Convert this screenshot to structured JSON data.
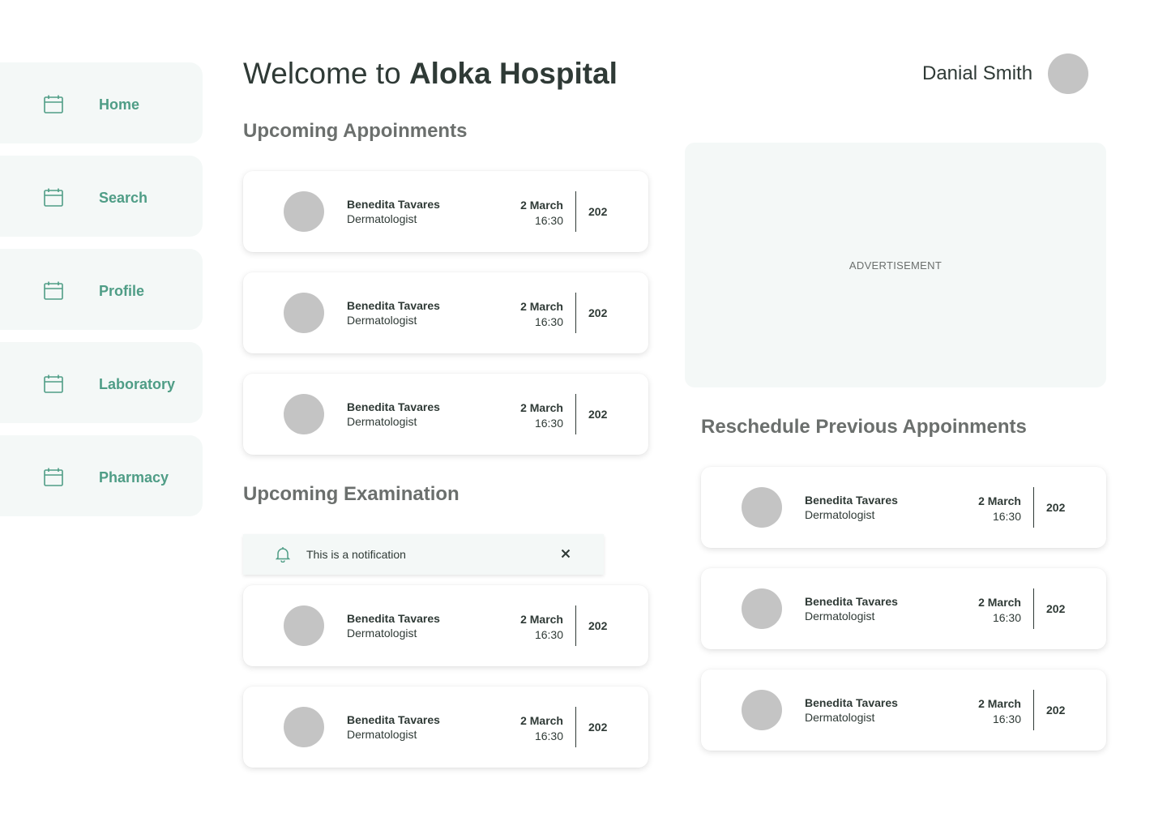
{
  "header": {
    "title_prefix": "Welcome to ",
    "title_brand": "Aloka Hospital",
    "user_name": "Danial Smith"
  },
  "sidebar": {
    "items": [
      {
        "label": "Home",
        "icon": "calendar-icon"
      },
      {
        "label": "Search",
        "icon": "calendar-icon"
      },
      {
        "label": "Profile",
        "icon": "calendar-icon"
      },
      {
        "label": "Laboratory",
        "icon": "calendar-icon"
      },
      {
        "label": "Pharmacy",
        "icon": "calendar-icon"
      }
    ]
  },
  "upcoming_appointments": {
    "title": "Upcoming  Appoinments",
    "cards": [
      {
        "name": "Benedita Tavares",
        "specialty": "Dermatologist",
        "date": "2 March",
        "time": "16:30",
        "room": "202"
      },
      {
        "name": "Benedita Tavares",
        "specialty": "Dermatologist",
        "date": "2 March",
        "time": "16:30",
        "room": "202"
      },
      {
        "name": "Benedita Tavares",
        "specialty": "Dermatologist",
        "date": "2 March",
        "time": "16:30",
        "room": "202"
      }
    ]
  },
  "upcoming_examination": {
    "title": "Upcoming  Examination",
    "notification": {
      "message": "This is a notification",
      "icon": "bell-icon",
      "close_icon": "close-icon"
    },
    "cards": [
      {
        "name": "Benedita Tavares",
        "specialty": "Dermatologist",
        "date": "2 March",
        "time": "16:30",
        "room": "202"
      },
      {
        "name": "Benedita Tavares",
        "specialty": "Dermatologist",
        "date": "2 March",
        "time": "16:30",
        "room": "202"
      }
    ]
  },
  "advertisement": {
    "label": "ADVERTISEMENT"
  },
  "reschedule": {
    "title": "Reschedule Previous  Appoinments",
    "cards": [
      {
        "name": "Benedita Tavares",
        "specialty": "Dermatologist",
        "date": "2 March",
        "time": "16:30",
        "room": "202"
      },
      {
        "name": "Benedita Tavares",
        "specialty": "Dermatologist",
        "date": "2 March",
        "time": "16:30",
        "room": "202"
      },
      {
        "name": "Benedita Tavares",
        "specialty": "Dermatologist",
        "date": "2 March",
        "time": "16:30",
        "room": "202"
      }
    ]
  },
  "colors": {
    "accent": "#4f9d86",
    "panel_bg": "#f4f8f7",
    "text_dark": "#2f3a36",
    "text_muted": "#6b6f6d",
    "avatar_placeholder": "#c4c4c4"
  }
}
